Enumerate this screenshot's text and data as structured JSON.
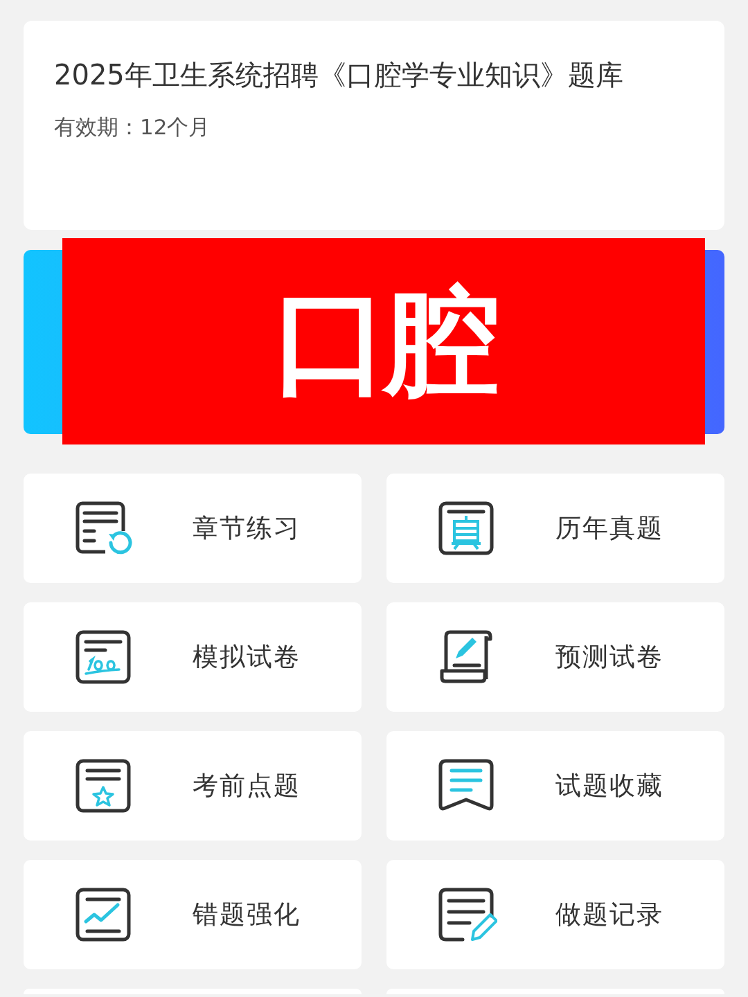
{
  "course": {
    "title": "2025年卫生系统招聘《口腔学专业知识》题库",
    "validity": "有效期：12个月"
  },
  "banner": {
    "label": "口腔"
  },
  "menu": [
    {
      "label": "章节练习"
    },
    {
      "label": "历年真题"
    },
    {
      "label": "模拟试卷"
    },
    {
      "label": "预测试卷"
    },
    {
      "label": "考前点题"
    },
    {
      "label": "试题收藏"
    },
    {
      "label": "错题强化"
    },
    {
      "label": "做题记录"
    }
  ]
}
